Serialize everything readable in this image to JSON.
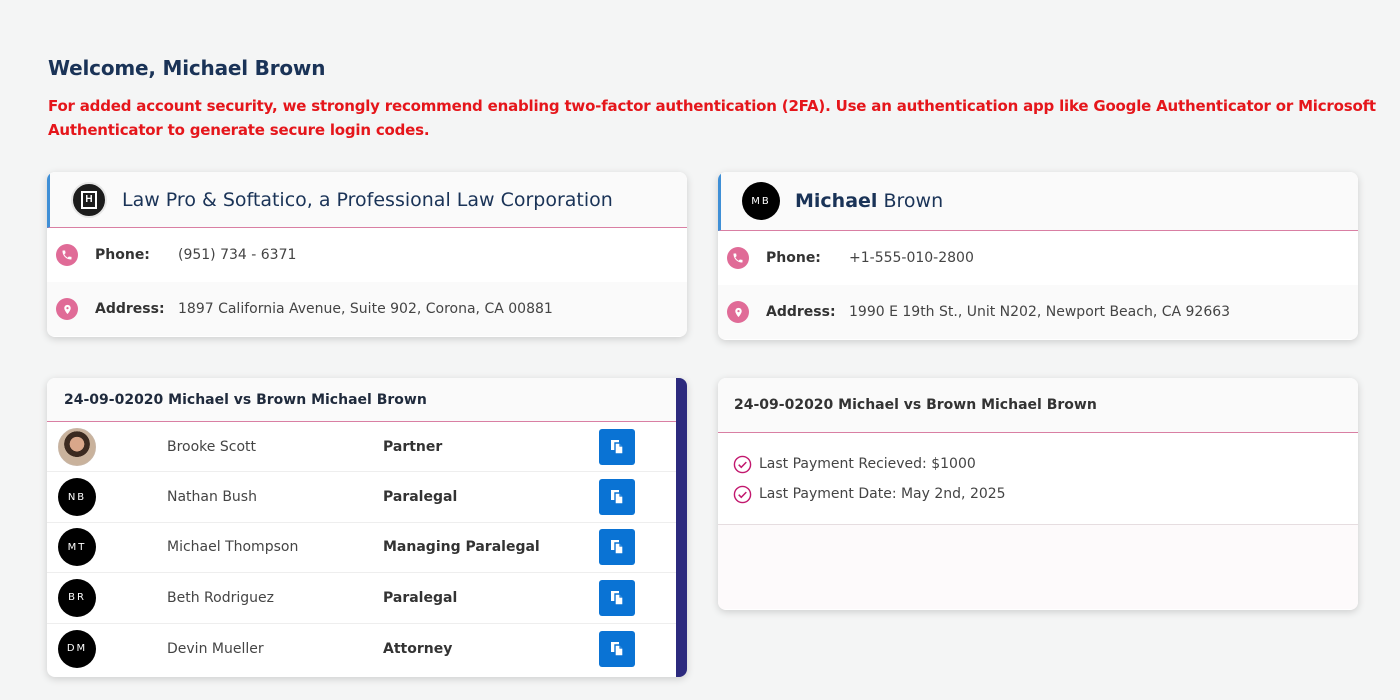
{
  "welcome": {
    "prefix": "Welcome, ",
    "first": "Michael",
    "last": "Brown"
  },
  "warning": "For added account security, we strongly recommend enabling two-factor authentication (2FA). Use an authentication app like Google Authenticator or Microsoft Authenticator to generate secure login codes.",
  "firm": {
    "name": "Law Pro & Softatico, a Professional Law Corporation",
    "logo_letter": "H",
    "phone_label": "Phone:",
    "phone": "(951) 734 - 6371",
    "address_label": "Address:",
    "address": "1897 California Avenue, Suite 902, Corona, CA 00881"
  },
  "client": {
    "initials": "MB",
    "first": "Michael",
    "last": "Brown",
    "phone_label": "Phone:",
    "phone": "+1-555-010-2800",
    "address_label": "Address:",
    "address": "1990 E 19th St., Unit N202, Newport Beach, CA 92663"
  },
  "team": {
    "case_title": "24-09-02020 Michael vs Brown Michael Brown",
    "members": [
      {
        "initials": "",
        "name": "Brooke Scott",
        "role": "Partner"
      },
      {
        "initials": "NB",
        "name": "Nathan Bush",
        "role": "Paralegal"
      },
      {
        "initials": "MT",
        "name": "Michael Thompson",
        "role": "Managing Paralegal"
      },
      {
        "initials": "BR",
        "name": "Beth Rodriguez",
        "role": "Paralegal"
      },
      {
        "initials": "DM",
        "name": "Devin Mueller",
        "role": "Attorney"
      }
    ]
  },
  "payment": {
    "case_title": "24-09-02020 Michael vs Brown Michael Brown",
    "last_payment": "Last Payment Recieved: $1000",
    "last_date": "Last Payment Date: May 2nd, 2025"
  },
  "colors": {
    "accent_pink": "#e06b97",
    "copy_button": "#0a73d4",
    "warning": "#e5161b",
    "title": "#1a3357"
  },
  "icons": {
    "phone": "phone-icon",
    "address": "location-pin-icon",
    "copy": "copy-icon",
    "check": "check-circle-icon"
  }
}
